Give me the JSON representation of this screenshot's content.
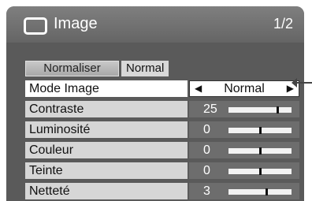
{
  "header": {
    "title": "Image",
    "page": "1/2",
    "icon": "screen-icon"
  },
  "normalize": {
    "button_label": "Normaliser",
    "state": "Normal"
  },
  "mode": {
    "label": "Mode Image",
    "value": "Normal"
  },
  "settings": [
    {
      "label": "Contraste",
      "value": "25",
      "level": 0.78
    },
    {
      "label": "Luminosité",
      "value": "0",
      "level": 0.5
    },
    {
      "label": "Couleur",
      "value": "0",
      "level": 0.5
    },
    {
      "label": "Teinte",
      "value": "0",
      "level": 0.5
    },
    {
      "label": "Netteté",
      "value": "3",
      "level": 0.6
    }
  ]
}
